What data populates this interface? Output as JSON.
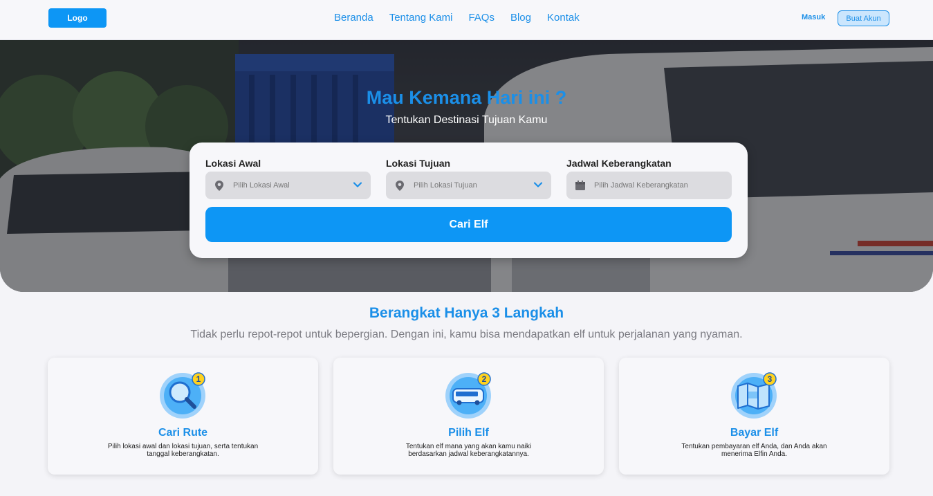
{
  "header": {
    "logo": "Logo",
    "nav": [
      "Beranda",
      "Tentang Kami",
      "FAQs",
      "Blog",
      "Kontak"
    ],
    "login": "Masuk",
    "register": "Buat Akun"
  },
  "hero": {
    "title": "Mau Kemana Hari ini ?",
    "subtitle": "Tentukan Destinasi Tujuan Kamu"
  },
  "search": {
    "origin_label": "Lokasi Awal",
    "origin_placeholder": "Pilih Lokasi Awal",
    "destination_label": "Lokasi Tujuan",
    "destination_placeholder": "Pilih Lokasi Tujuan",
    "schedule_label": "Jadwal Keberangkatan",
    "schedule_placeholder": "Pilih Jadwal Keberangkatan",
    "button": "Cari Elf"
  },
  "steps_section": {
    "title": "Berangkat Hanya 3 Langkah",
    "subtitle": "Tidak perlu repot-repot untuk bepergian. Dengan ini, kamu bisa mendapatkan elf untuk perjalanan yang nyaman.",
    "steps": [
      {
        "number": "1",
        "title": "Cari Rute",
        "desc": "Pilih lokasi awal dan lokasi tujuan, serta tentukan tanggal keberangkatan.",
        "icon": "magnifier-icon"
      },
      {
        "number": "2",
        "title": "Pilih Elf",
        "desc": "Tentukan elf mana yang akan kamu naiki berdasarkan jadwal keberangkatannya.",
        "icon": "bus-icon"
      },
      {
        "number": "3",
        "title": "Bayar Elf",
        "desc": "Tentukan pembayaran elf Anda, dan Anda akan menerima Elfin Anda.",
        "icon": "map-icon"
      }
    ]
  },
  "colors": {
    "accent": "#0d96f5",
    "text_blue": "#1b8fe8"
  }
}
